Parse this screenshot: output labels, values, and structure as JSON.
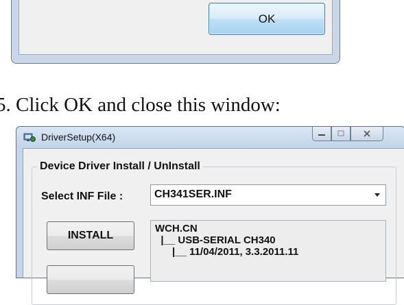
{
  "top_dialog": {
    "ok_label": "OK"
  },
  "instruction": "5. Click OK and close this window:",
  "window": {
    "title": "DriverSetup(X64)",
    "icon": "driver-setup-icon",
    "controls": {
      "minimize": "minimize-icon",
      "maximize": "maximize-icon",
      "close": "close-icon"
    }
  },
  "group": {
    "title": "Device Driver Install / UnInstall",
    "select_label": "Select INF File :",
    "inf_file": "CH341SER.INF",
    "install_label": "INSTALL",
    "info_lines": [
      "WCH.CN",
      "  |__ USB-SERIAL CH340",
      "      |__ 11/04/2011, 3.3.2011.11"
    ]
  }
}
